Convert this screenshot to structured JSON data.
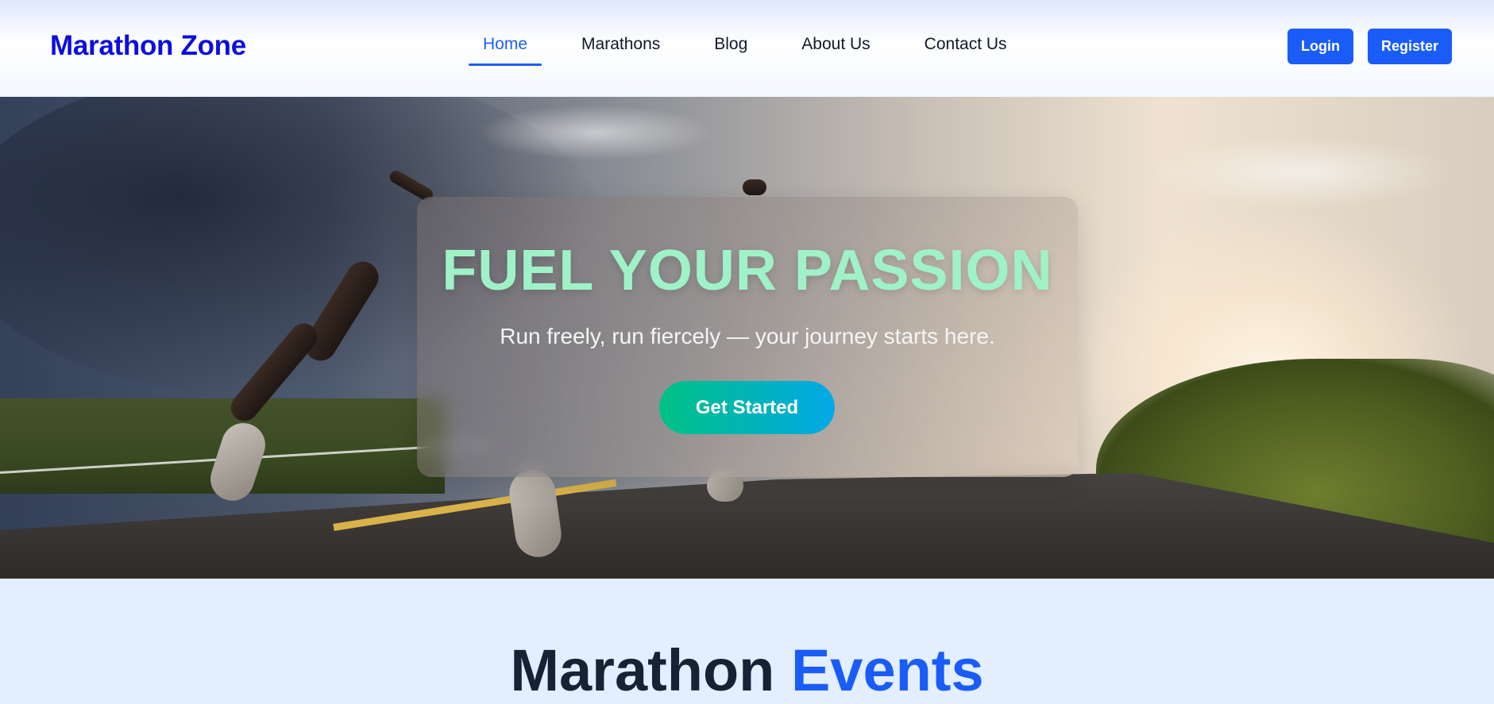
{
  "brand": "Marathon Zone",
  "nav": {
    "items": [
      {
        "label": "Home",
        "active": true
      },
      {
        "label": "Marathons",
        "active": false
      },
      {
        "label": "Blog",
        "active": false
      },
      {
        "label": "About Us",
        "active": false
      },
      {
        "label": "Contact Us",
        "active": false
      }
    ]
  },
  "auth": {
    "login_label": "Login",
    "register_label": "Register"
  },
  "hero": {
    "title": "FUEL YOUR PASSION",
    "subtitle": "Run freely, run fiercely — your journey starts here.",
    "cta_label": "Get Started"
  },
  "events": {
    "title_main": "Marathon",
    "title_accent": "Events"
  },
  "colors": {
    "brand": "#0d0ddd",
    "accent": "#1a5cf8",
    "hero_title": "#9ff2c8",
    "cta_start": "#00c184",
    "cta_end": "#03a8e8",
    "section_bg": "#e3eefe"
  }
}
